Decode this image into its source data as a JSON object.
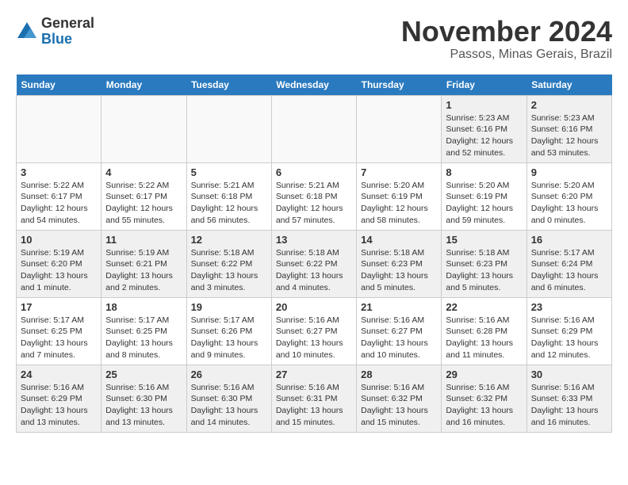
{
  "logo": {
    "general": "General",
    "blue": "Blue"
  },
  "header": {
    "month": "November 2024",
    "location": "Passos, Minas Gerais, Brazil"
  },
  "weekdays": [
    "Sunday",
    "Monday",
    "Tuesday",
    "Wednesday",
    "Thursday",
    "Friday",
    "Saturday"
  ],
  "weeks": [
    [
      {
        "day": "",
        "info": "",
        "empty": true
      },
      {
        "day": "",
        "info": "",
        "empty": true
      },
      {
        "day": "",
        "info": "",
        "empty": true
      },
      {
        "day": "",
        "info": "",
        "empty": true
      },
      {
        "day": "",
        "info": "",
        "empty": true
      },
      {
        "day": "1",
        "info": "Sunrise: 5:23 AM\nSunset: 6:16 PM\nDaylight: 12 hours\nand 52 minutes.",
        "empty": false
      },
      {
        "day": "2",
        "info": "Sunrise: 5:23 AM\nSunset: 6:16 PM\nDaylight: 12 hours\nand 53 minutes.",
        "empty": false
      }
    ],
    [
      {
        "day": "3",
        "info": "Sunrise: 5:22 AM\nSunset: 6:17 PM\nDaylight: 12 hours\nand 54 minutes.",
        "empty": false
      },
      {
        "day": "4",
        "info": "Sunrise: 5:22 AM\nSunset: 6:17 PM\nDaylight: 12 hours\nand 55 minutes.",
        "empty": false
      },
      {
        "day": "5",
        "info": "Sunrise: 5:21 AM\nSunset: 6:18 PM\nDaylight: 12 hours\nand 56 minutes.",
        "empty": false
      },
      {
        "day": "6",
        "info": "Sunrise: 5:21 AM\nSunset: 6:18 PM\nDaylight: 12 hours\nand 57 minutes.",
        "empty": false
      },
      {
        "day": "7",
        "info": "Sunrise: 5:20 AM\nSunset: 6:19 PM\nDaylight: 12 hours\nand 58 minutes.",
        "empty": false
      },
      {
        "day": "8",
        "info": "Sunrise: 5:20 AM\nSunset: 6:19 PM\nDaylight: 12 hours\nand 59 minutes.",
        "empty": false
      },
      {
        "day": "9",
        "info": "Sunrise: 5:20 AM\nSunset: 6:20 PM\nDaylight: 13 hours\nand 0 minutes.",
        "empty": false
      }
    ],
    [
      {
        "day": "10",
        "info": "Sunrise: 5:19 AM\nSunset: 6:20 PM\nDaylight: 13 hours\nand 1 minute.",
        "empty": false
      },
      {
        "day": "11",
        "info": "Sunrise: 5:19 AM\nSunset: 6:21 PM\nDaylight: 13 hours\nand 2 minutes.",
        "empty": false
      },
      {
        "day": "12",
        "info": "Sunrise: 5:18 AM\nSunset: 6:22 PM\nDaylight: 13 hours\nand 3 minutes.",
        "empty": false
      },
      {
        "day": "13",
        "info": "Sunrise: 5:18 AM\nSunset: 6:22 PM\nDaylight: 13 hours\nand 4 minutes.",
        "empty": false
      },
      {
        "day": "14",
        "info": "Sunrise: 5:18 AM\nSunset: 6:23 PM\nDaylight: 13 hours\nand 5 minutes.",
        "empty": false
      },
      {
        "day": "15",
        "info": "Sunrise: 5:18 AM\nSunset: 6:23 PM\nDaylight: 13 hours\nand 5 minutes.",
        "empty": false
      },
      {
        "day": "16",
        "info": "Sunrise: 5:17 AM\nSunset: 6:24 PM\nDaylight: 13 hours\nand 6 minutes.",
        "empty": false
      }
    ],
    [
      {
        "day": "17",
        "info": "Sunrise: 5:17 AM\nSunset: 6:25 PM\nDaylight: 13 hours\nand 7 minutes.",
        "empty": false
      },
      {
        "day": "18",
        "info": "Sunrise: 5:17 AM\nSunset: 6:25 PM\nDaylight: 13 hours\nand 8 minutes.",
        "empty": false
      },
      {
        "day": "19",
        "info": "Sunrise: 5:17 AM\nSunset: 6:26 PM\nDaylight: 13 hours\nand 9 minutes.",
        "empty": false
      },
      {
        "day": "20",
        "info": "Sunrise: 5:16 AM\nSunset: 6:27 PM\nDaylight: 13 hours\nand 10 minutes.",
        "empty": false
      },
      {
        "day": "21",
        "info": "Sunrise: 5:16 AM\nSunset: 6:27 PM\nDaylight: 13 hours\nand 10 minutes.",
        "empty": false
      },
      {
        "day": "22",
        "info": "Sunrise: 5:16 AM\nSunset: 6:28 PM\nDaylight: 13 hours\nand 11 minutes.",
        "empty": false
      },
      {
        "day": "23",
        "info": "Sunrise: 5:16 AM\nSunset: 6:29 PM\nDaylight: 13 hours\nand 12 minutes.",
        "empty": false
      }
    ],
    [
      {
        "day": "24",
        "info": "Sunrise: 5:16 AM\nSunset: 6:29 PM\nDaylight: 13 hours\nand 13 minutes.",
        "empty": false
      },
      {
        "day": "25",
        "info": "Sunrise: 5:16 AM\nSunset: 6:30 PM\nDaylight: 13 hours\nand 13 minutes.",
        "empty": false
      },
      {
        "day": "26",
        "info": "Sunrise: 5:16 AM\nSunset: 6:30 PM\nDaylight: 13 hours\nand 14 minutes.",
        "empty": false
      },
      {
        "day": "27",
        "info": "Sunrise: 5:16 AM\nSunset: 6:31 PM\nDaylight: 13 hours\nand 15 minutes.",
        "empty": false
      },
      {
        "day": "28",
        "info": "Sunrise: 5:16 AM\nSunset: 6:32 PM\nDaylight: 13 hours\nand 15 minutes.",
        "empty": false
      },
      {
        "day": "29",
        "info": "Sunrise: 5:16 AM\nSunset: 6:32 PM\nDaylight: 13 hours\nand 16 minutes.",
        "empty": false
      },
      {
        "day": "30",
        "info": "Sunrise: 5:16 AM\nSunset: 6:33 PM\nDaylight: 13 hours\nand 16 minutes.",
        "empty": false
      }
    ]
  ]
}
